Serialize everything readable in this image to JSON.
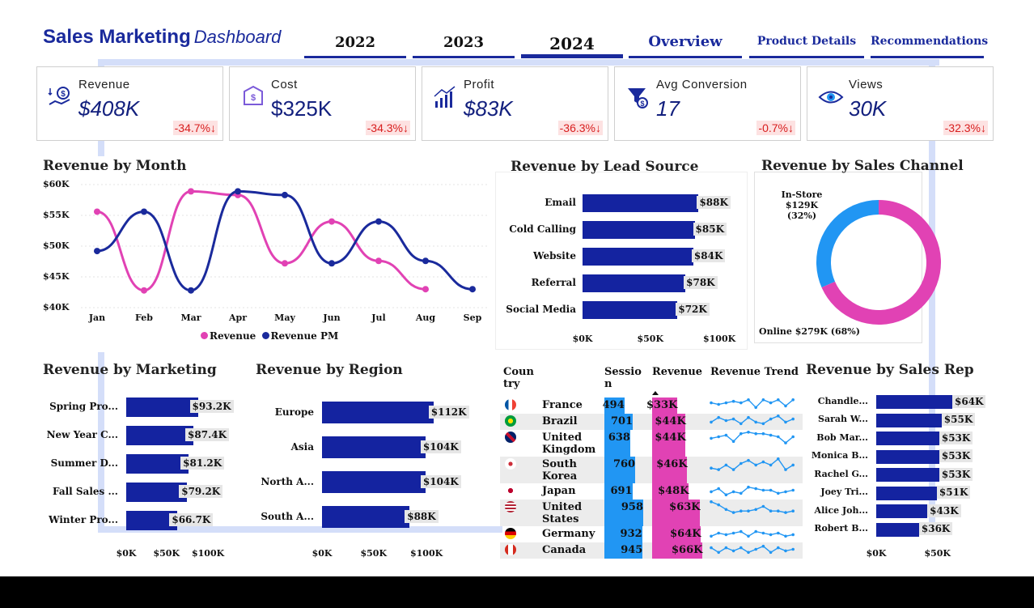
{
  "header": {
    "title": "Sales Marketing",
    "subtitle": "Dashboard"
  },
  "tabs": [
    "2022",
    "2023",
    "2024",
    "Overview",
    "Product Details",
    "Recommendations"
  ],
  "kpis": [
    {
      "label": "Revenue",
      "value": "$408K",
      "change": "-34.7%↓",
      "icon": "revenue-icon"
    },
    {
      "label": "Cost",
      "value": "$325K",
      "change": "-34.3%↓",
      "icon": "cost-icon"
    },
    {
      "label": "Profit",
      "value": "$83K",
      "change": "-36.3%↓",
      "icon": "profit-icon"
    },
    {
      "label": "Avg Conversion",
      "value": "17",
      "change": "-0.7%↓",
      "icon": "conversion-icon"
    },
    {
      "label": "Views",
      "value": "30K",
      "change": "-32.3%↓",
      "icon": "views-icon"
    }
  ],
  "colors": {
    "navy": "#1423a0",
    "pink": "#e142b4",
    "blue": "#2196f3",
    "red": "#d81e1e"
  },
  "revenue_by_month": {
    "title": "Revenue by Month",
    "chart_data": {
      "type": "line",
      "categories": [
        "Jan",
        "Feb",
        "Mar",
        "Apr",
        "May",
        "Jun",
        "Jul",
        "Aug",
        "Sep"
      ],
      "y_ticks": [
        "$60K",
        "$55K",
        "$50K",
        "$45K",
        "$40K"
      ],
      "ylim": [
        40,
        60
      ],
      "series": [
        {
          "name": "Revenue",
          "color": "#e142b4",
          "values": [
            55.6,
            42.8,
            58.9,
            58.3,
            47.2,
            54.0,
            47.6,
            43.0,
            null
          ]
        },
        {
          "name": "Revenue PM",
          "color": "#1a2a9c",
          "values": [
            49.2,
            55.6,
            42.8,
            58.9,
            58.3,
            47.2,
            54.0,
            47.6,
            43.0
          ]
        }
      ]
    }
  },
  "lead_source": {
    "title": "Revenue by Lead Source",
    "chart_data": {
      "type": "bar",
      "categories": [
        "Email",
        "Cold Calling",
        "Website",
        "Referral",
        "Social Media"
      ],
      "values": [
        88,
        85,
        84,
        78,
        72
      ],
      "labels": [
        "$88K",
        "$85K",
        "$84K",
        "$78K",
        "$72K"
      ],
      "xticks": [
        "$0K",
        "$50K",
        "$100K"
      ],
      "xmax": 100
    }
  },
  "sales_channel": {
    "title": "Revenue by Sales Channel",
    "chart_data": {
      "type": "pie",
      "slices": [
        {
          "name": "In-Store",
          "value": 129,
          "label": "In-Store",
          "detail": "$129K (32%)"
        },
        {
          "name": "Online",
          "value": 279,
          "label": "Online $279K (68%)"
        }
      ]
    }
  },
  "marketing": {
    "title": "Revenue by Marketing",
    "chart_data": {
      "type": "bar",
      "categories": [
        "Spring Pro...",
        "New Year C...",
        "Summer D...",
        "Fall Sales ...",
        "Winter Pro..."
      ],
      "values": [
        93.2,
        87.4,
        81.2,
        79.2,
        66.7
      ],
      "labels": [
        "$93.2K",
        "$87.4K",
        "$81.2K",
        "$79.2K",
        "$66.7K"
      ],
      "xticks": [
        "$0K",
        "$50K",
        "$100K"
      ],
      "xmax": 100
    }
  },
  "region": {
    "title": "Revenue by Region",
    "chart_data": {
      "type": "bar",
      "categories": [
        "Europe",
        "Asia",
        "North A...",
        "South A..."
      ],
      "values": [
        112,
        104,
        104,
        88
      ],
      "labels": [
        "$112K",
        "$104K",
        "$104K",
        "$88K"
      ],
      "xticks": [
        "$0K",
        "$50K",
        "$100K"
      ],
      "xmax": 100
    }
  },
  "country_table": {
    "headers": [
      "Coun try",
      "Sessio n",
      "Revenue",
      "Revenue Trend"
    ],
    "rows": [
      {
        "country": "France",
        "sessions": "494",
        "revenue": "$33K",
        "s": 494,
        "r": 33,
        "trend": [
          6,
          5,
          6,
          7,
          6,
          8,
          3,
          8,
          6,
          8,
          4,
          8
        ]
      },
      {
        "country": "Brazil",
        "sessions": "701",
        "revenue": "$44K",
        "s": 701,
        "r": 44,
        "trend": [
          4,
          7,
          5,
          6,
          3,
          7,
          4,
          3,
          6,
          8,
          4,
          6
        ]
      },
      {
        "country": "United Kingdom",
        "sessions": "638",
        "revenue": "$44K",
        "s": 638,
        "r": 44,
        "trend": [
          4,
          5,
          6,
          2,
          7,
          8,
          7,
          7,
          6,
          5,
          1,
          5
        ]
      },
      {
        "country": "South Korea",
        "sessions": "760",
        "revenue": "$46K",
        "s": 760,
        "r": 46,
        "trend": [
          2,
          1,
          4,
          1,
          5,
          7,
          4,
          6,
          4,
          8,
          1,
          4
        ]
      },
      {
        "country": "Japan",
        "sessions": "691",
        "revenue": "$48K",
        "s": 691,
        "r": 48,
        "trend": [
          4,
          6,
          2,
          4,
          3,
          7,
          6,
          5,
          5,
          3,
          4,
          5
        ]
      },
      {
        "country": "United States",
        "sessions": "958",
        "revenue": "$63K",
        "s": 958,
        "r": 63,
        "trend": [
          8,
          6,
          3,
          1,
          2,
          2,
          3,
          5,
          2,
          2,
          1,
          2
        ]
      },
      {
        "country": "Germany",
        "sessions": "932",
        "revenue": "$64K",
        "s": 932,
        "r": 64,
        "trend": [
          3,
          5,
          4,
          5,
          6,
          3,
          6,
          5,
          4,
          5,
          3,
          4
        ]
      },
      {
        "country": "Canada",
        "sessions": "945",
        "revenue": "$66K",
        "s": 945,
        "r": 66,
        "trend": [
          6,
          3,
          6,
          4,
          6,
          3,
          5,
          7,
          3,
          6,
          4,
          5
        ]
      }
    ]
  },
  "sales_rep": {
    "title": "Revenue by Sales Rep",
    "chart_data": {
      "type": "bar",
      "categories": [
        "Chandle...",
        "Sarah W...",
        "Bob Mar...",
        "Monica B...",
        "Rachel G...",
        "Joey Tri...",
        "Alice Joh...",
        "Robert B..."
      ],
      "values": [
        64,
        55,
        53,
        53,
        53,
        51,
        43,
        36
      ],
      "labels": [
        "$64K",
        "$55K",
        "$53K",
        "$53K",
        "$53K",
        "$51K",
        "$43K",
        "$36K"
      ],
      "xticks": [
        "$0K",
        "$50K"
      ],
      "xmax": 64
    }
  }
}
